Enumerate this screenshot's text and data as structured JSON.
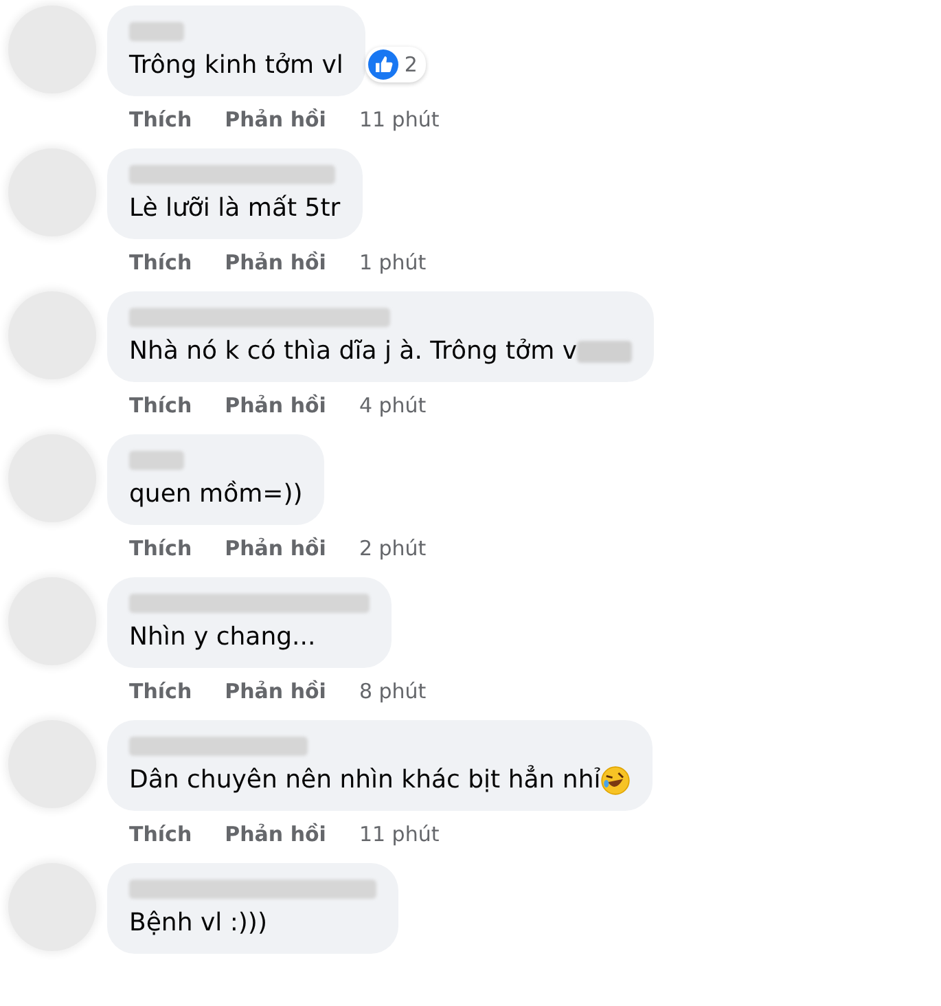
{
  "comments": [
    {
      "text": "Trông kinh tởm vl",
      "reaction_count": "2",
      "emoji": false,
      "redacted_end": false,
      "actions": {
        "like": "Thích",
        "reply": "Phản hồi",
        "time": "11 phút"
      }
    },
    {
      "text": "Lè lưỡi là mất 5tr",
      "emoji": false,
      "redacted_end": false,
      "actions": {
        "like": "Thích",
        "reply": "Phản hồi",
        "time": "1 phút"
      }
    },
    {
      "text": "Nhà nó k có thìa dĩa j à. Trông tởm v",
      "emoji": false,
      "redacted_end": true,
      "actions": {
        "like": "Thích",
        "reply": "Phản hồi",
        "time": "4 phút"
      }
    },
    {
      "text": "quen mồm=))",
      "emoji": false,
      "redacted_end": false,
      "actions": {
        "like": "Thích",
        "reply": "Phản hồi",
        "time": "2 phút"
      }
    },
    {
      "text": "Nhìn y chang...",
      "emoji": false,
      "redacted_end": false,
      "actions": {
        "like": "Thích",
        "reply": "Phản hồi",
        "time": "8 phút"
      }
    },
    {
      "text": "Dân chuyên nên nhìn khác bịt hẳn nhỉ",
      "emoji": true,
      "redacted_end": false,
      "actions": {
        "like": "Thích",
        "reply": "Phản hồi",
        "time": "11 phút"
      }
    },
    {
      "text": "Bệnh vl :)))",
      "emoji": false,
      "redacted_end": false
    }
  ]
}
